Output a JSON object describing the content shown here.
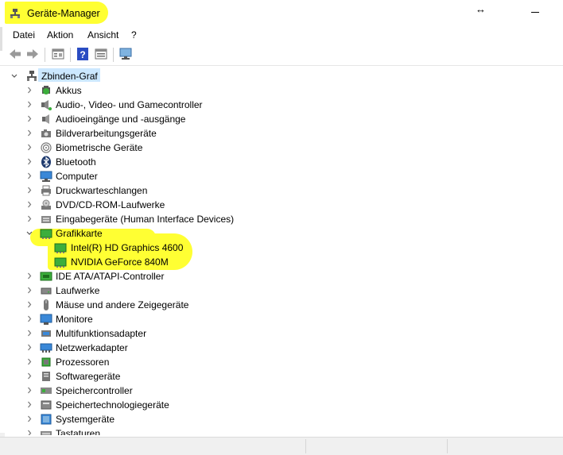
{
  "window": {
    "title": "Geräte-Manager",
    "resize_glyph": "↔"
  },
  "menu": [
    "Datei",
    "Aktion",
    "Ansicht",
    "?"
  ],
  "toolbar": {
    "buttons": [
      "back-icon",
      "forward-icon",
      "properties-icon",
      "help-icon",
      "view-icon",
      "monitor-icon"
    ]
  },
  "tree": {
    "root": "Zbinden-Graf",
    "categories": [
      "Akkus",
      "Audio-, Video- und Gamecontroller",
      "Audioeingänge und -ausgänge",
      "Bildverarbeitungsgeräte",
      "Biometrische Geräte",
      "Bluetooth",
      "Computer",
      "Druckwarteschlangen",
      "DVD/CD-ROM-Laufwerke",
      "Eingabegeräte (Human Interface Devices)",
      "Grafikkarte",
      "IDE ATA/ATAPI-Controller",
      "Laufwerke",
      "Mäuse und andere Zeigegeräte",
      "Monitore",
      "Multifunktionsadapter",
      "Netzwerkadapter",
      "Prozessoren",
      "Softwaregeräte",
      "Speichercontroller",
      "Speichertechnologiegeräte",
      "Systemgeräte",
      "Tastaturen"
    ],
    "graphics_children": [
      "Intel(R) HD Graphics 4600",
      "NVIDIA GeForce 840M"
    ]
  },
  "colors": {
    "highlight": "#ffff33",
    "root_selection": "#cce8ff",
    "gpu_green": "#3cae3c"
  }
}
